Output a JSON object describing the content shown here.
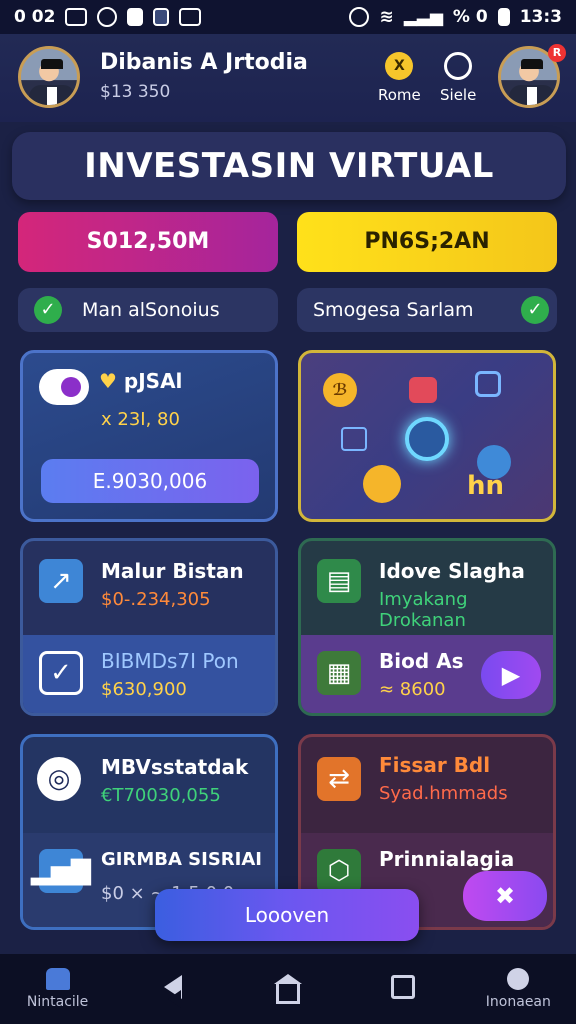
{
  "statusbar": {
    "left_text": "0 02",
    "battery": "% 0",
    "time": "13:3"
  },
  "header": {
    "user_name": "Dibanis A Jrtodia",
    "user_balance": "$13 350",
    "coin_symbol": "X",
    "home_label": "Rome",
    "profile_label": "Siele",
    "badge": "R"
  },
  "title": "INVESTASIN VIRTUAL",
  "pills": {
    "left": "S012,50M",
    "right": "PN6S;2AN"
  },
  "checks": {
    "left": "Man alSonoius",
    "right": "Smogesa Sarlam"
  },
  "card_a": {
    "label": "pJSAl",
    "value": "x 23I, 80",
    "amount": "E.9030,006"
  },
  "card_b": {
    "caption": "hn",
    "coin_mark": "ℬ"
  },
  "card_c": {
    "top_title": "Malur Bistan",
    "top_value": "$0-.234,305",
    "bottom_title": "BIBMDs7I Pon",
    "bottom_value": "$630,900"
  },
  "card_d": {
    "top_title": "Idove Slagha",
    "top_sub": "Imyakang Drokanan",
    "bottom_title": "Biod As",
    "bottom_value": "≈ 8600"
  },
  "card_e": {
    "top_title": "MBVsstatdak",
    "top_value": "€T70030,055",
    "bottom_title": "GIRMBA SISRIAI",
    "bottom_value": "$0 × ~ 1 5 0 0"
  },
  "card_f": {
    "top_title": "Fissar Bdl",
    "top_sub": "Syad.hmmads",
    "bottom_title": "Prinnialagia"
  },
  "overlay_button": "Loooven",
  "nav": {
    "left_label": "Nintacile",
    "right_label": "Inonaean"
  },
  "colors": {
    "background": "#1b2145",
    "magenta": "#d4267a",
    "yellow": "#ffe11a",
    "green_check": "#2fae4c",
    "purple": "#7a4af0"
  }
}
